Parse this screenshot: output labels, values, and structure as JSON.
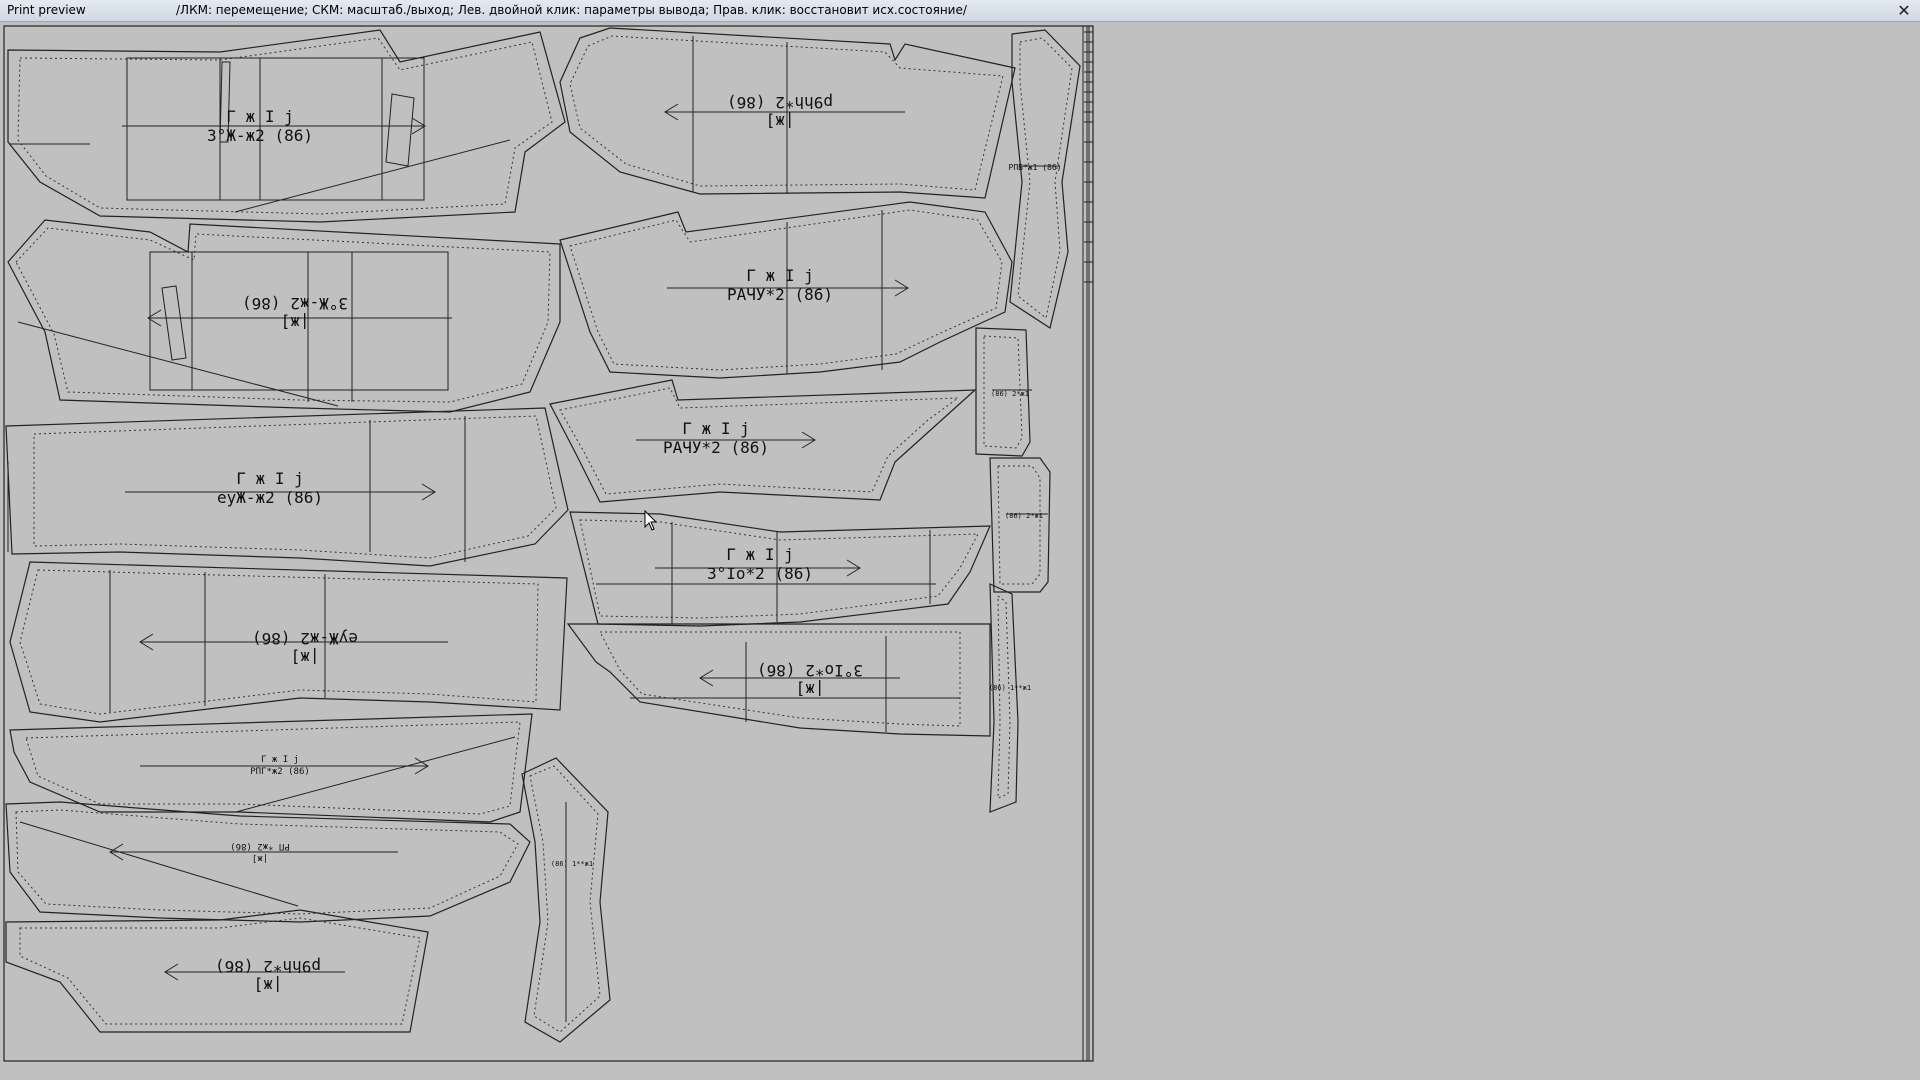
{
  "window": {
    "title": "Print preview",
    "hint": "/ЛКМ: перемещение;  СКМ: масштаб./выход;  Лев. двойной клик: параметры вывода;  Прав. клик: восстановит исх.состояние/",
    "close_icon": "close-icon"
  },
  "pieces": [
    {
      "id": "p1",
      "line1": "Г ж I j",
      "line2": "З°Ж-ж2 (86)"
    },
    {
      "id": "p2",
      "line1": "|ж]",
      "line2": "p9hh*2 (86)"
    },
    {
      "id": "p3",
      "line1": "|ж]",
      "line2": "З°Ж-ж2 (86)"
    },
    {
      "id": "p4",
      "line1": "Г ж I j",
      "line2": "РАЧУ*2 (86)"
    },
    {
      "id": "p5",
      "line1": "Г ж I j",
      "line2": "РАЧУ*2 (86)"
    },
    {
      "id": "p6",
      "line1": "Г ж I j",
      "line2": "еуЖ-ж2 (86)"
    },
    {
      "id": "p7",
      "line1": "Г ж I j",
      "line2": "З°Iо*2 (86)"
    },
    {
      "id": "p8",
      "line1": "|ж]",
      "line2": "еуЖ-ж2 (86)"
    },
    {
      "id": "p9",
      "line1": "|ж]",
      "line2": "З°Iо*2 (86)"
    },
    {
      "id": "p10",
      "line1": "Г ж I j",
      "line2": "РПГ*ж2 (86)"
    },
    {
      "id": "p11",
      "line1": "|ж]",
      "line2": "РП *ж2 (86)"
    },
    {
      "id": "p12",
      "line1": "|ж]",
      "line2": "p9hh*2 (86)"
    }
  ],
  "small_labels": {
    "s1": "РПБ*ж1 (86)",
    "s2": "(86) 2*ж1",
    "s3": "(86) 2*ж1",
    "s4": "(86) 1**ж1",
    "s5": "(86) 1**ж1"
  }
}
